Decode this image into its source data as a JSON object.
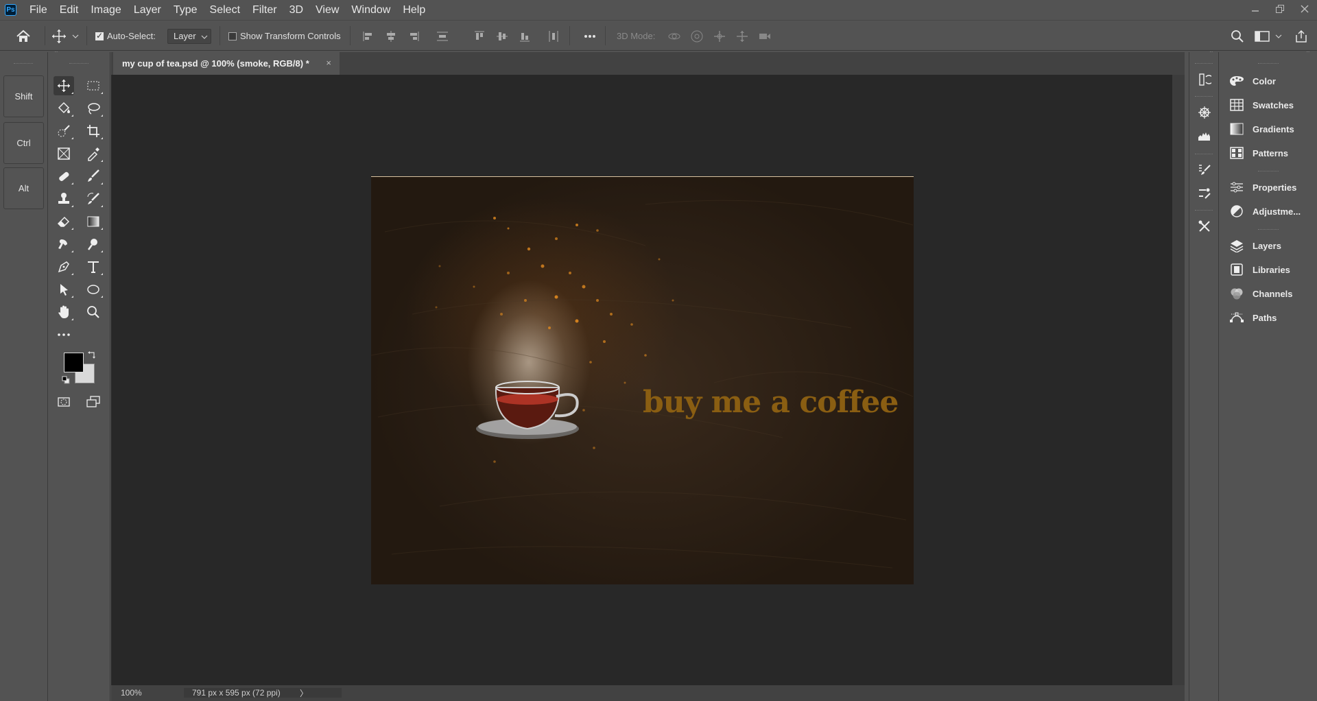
{
  "menubar": {
    "app_badge": "Ps",
    "items": [
      "File",
      "Edit",
      "Image",
      "Layer",
      "Type",
      "Select",
      "Filter",
      "3D",
      "View",
      "Window",
      "Help"
    ]
  },
  "options": {
    "auto_select_label": "Auto-Select:",
    "auto_select_checked": true,
    "auto_select_target": "Layer",
    "show_transform_label": "Show Transform Controls",
    "show_transform_checked": false,
    "mode_3d_label": "3D Mode:"
  },
  "modifier_keys": [
    "Shift",
    "Ctrl",
    "Alt"
  ],
  "document": {
    "tab_title": "my cup of tea.psd @ 100% (smoke, RGB/8) *",
    "canvas_text": "buy me a coffee",
    "zoom": "100%",
    "doc_info": "791 px x 595 px (72 ppi)"
  },
  "panels": {
    "group1": [
      "Color",
      "Swatches",
      "Gradients",
      "Patterns"
    ],
    "group2": [
      "Properties",
      "Adjustme..."
    ],
    "group3": [
      "Layers",
      "Libraries",
      "Channels",
      "Paths"
    ]
  },
  "colors": {
    "foreground": "#000000",
    "background": "#d9d9d9",
    "headline": "#8a5e12",
    "ps_accent": "#31a8ff"
  }
}
